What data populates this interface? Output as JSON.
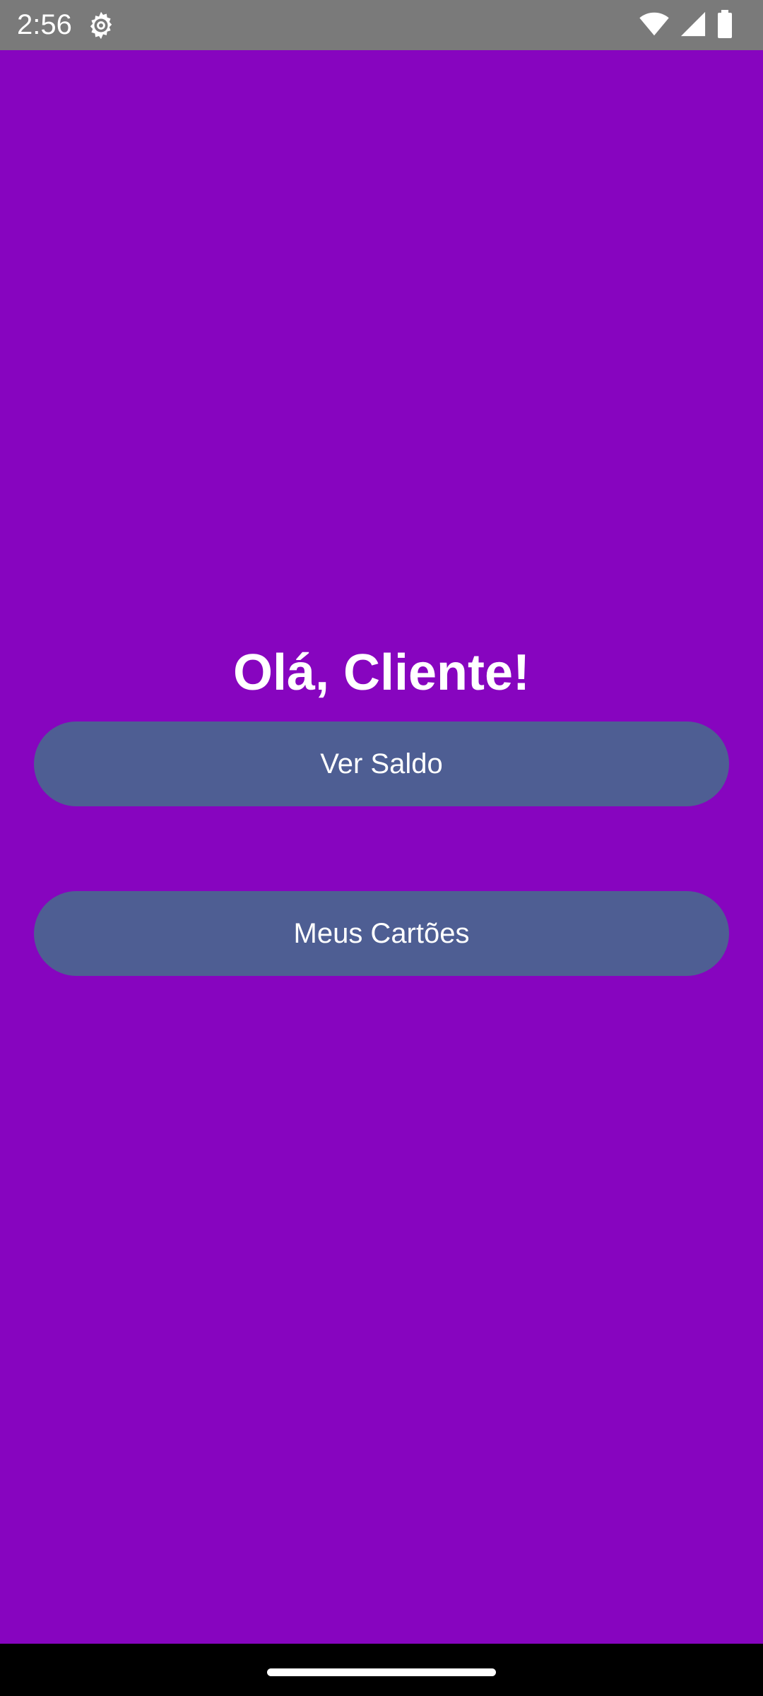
{
  "status_bar": {
    "time": "2:56",
    "icons": [
      "gear-icon",
      "wifi-icon",
      "signal-icon",
      "battery-icon"
    ]
  },
  "main": {
    "greeting": "Olá, Cliente!",
    "buttons": [
      {
        "label": "Ver Saldo"
      },
      {
        "label": "Meus Cartões"
      }
    ]
  },
  "colors": {
    "background": "#8705bf",
    "button": "#4e5e93",
    "status_bar": "#7a7a7a",
    "nav_bar": "#000000",
    "text": "#ffffff"
  }
}
